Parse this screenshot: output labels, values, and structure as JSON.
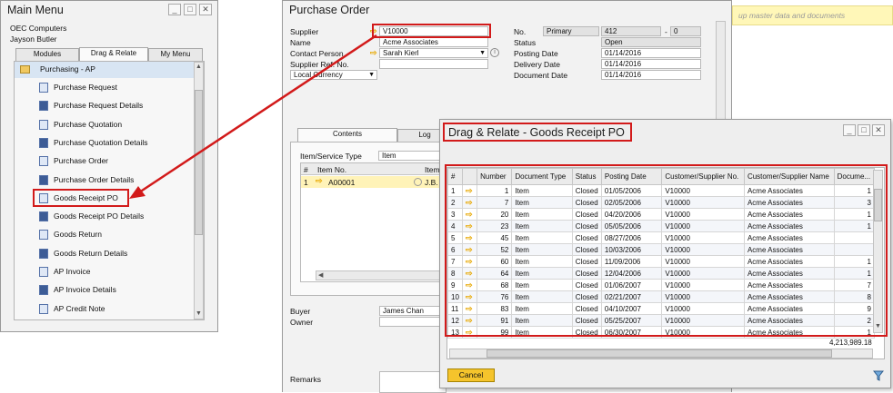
{
  "main_menu": {
    "title": "Main Menu",
    "company": "OEC Computers",
    "user": "Jayson Butler",
    "tabs": [
      "Modules",
      "Drag & Relate",
      "My Menu"
    ],
    "folder": "Purchasing - AP",
    "items": [
      {
        "label": "Purchase Request",
        "icon": "document-icon"
      },
      {
        "label": "Purchase Request Details",
        "icon": "report-icon"
      },
      {
        "label": "Purchase Quotation",
        "icon": "document-icon"
      },
      {
        "label": "Purchase Quotation Details",
        "icon": "report-icon"
      },
      {
        "label": "Purchase Order",
        "icon": "document-icon"
      },
      {
        "label": "Purchase Order Details",
        "icon": "report-icon"
      },
      {
        "label": "Goods Receipt PO",
        "icon": "document-icon"
      },
      {
        "label": "Goods Receipt PO Details",
        "icon": "report-icon"
      },
      {
        "label": "Goods Return",
        "icon": "document-icon"
      },
      {
        "label": "Goods Return Details",
        "icon": "report-icon"
      },
      {
        "label": "AP Invoice",
        "icon": "document-icon"
      },
      {
        "label": "AP Invoice Details",
        "icon": "report-icon"
      },
      {
        "label": "AP Credit Note",
        "icon": "document-icon"
      }
    ]
  },
  "purchase_order": {
    "title": "Purchase Order",
    "supplier_label": "Supplier",
    "supplier_value": "V10000",
    "name_label": "Name",
    "name_value": "Acme Associates",
    "contact_label": "Contact Person",
    "contact_value": "Sarah Kierl",
    "supplier_ref_label": "Supplier Ref. No.",
    "currency_value": "Local Currency",
    "no_label": "No.",
    "no_series": "Primary",
    "no_value": "412",
    "no_dash": "-",
    "no_suffix": "0",
    "status_label": "Status",
    "status_value": "Open",
    "posting_label": "Posting Date",
    "posting_value": "01/14/2016",
    "delivery_label": "Delivery Date",
    "delivery_value": "01/14/2016",
    "docdate_label": "Document Date",
    "docdate_value": "01/14/2016",
    "tabs": [
      "Contents",
      "Log"
    ],
    "item_type_label": "Item/Service Type",
    "item_type_value": "Item",
    "grid_headers": [
      "#",
      "Item No.",
      "Item"
    ],
    "grid_row": {
      "num": "1",
      "item_no": "A00001",
      "item_desc": "J.B. ("
    },
    "buyer_label": "Buyer",
    "buyer_value": "James Chan",
    "owner_label": "Owner",
    "remarks_label": "Remarks"
  },
  "background_hint": "up master data and documents",
  "drag_relate": {
    "title": "Drag & Relate - Goods Receipt PO",
    "headers": [
      "#",
      "",
      "Number",
      "Document Type",
      "Status",
      "Posting Date",
      "Customer/Supplier No.",
      "Customer/Supplier Name",
      "Docume..."
    ],
    "rows": [
      {
        "idx": "1",
        "number": "1",
        "type": "Item",
        "status": "Closed",
        "date": "01/05/2006",
        "cust_no": "V10000",
        "cust_name": "Acme Associates",
        "doc": "1"
      },
      {
        "idx": "2",
        "number": "7",
        "type": "Item",
        "status": "Closed",
        "date": "02/05/2006",
        "cust_no": "V10000",
        "cust_name": "Acme Associates",
        "doc": "3"
      },
      {
        "idx": "3",
        "number": "20",
        "type": "Item",
        "status": "Closed",
        "date": "04/20/2006",
        "cust_no": "V10000",
        "cust_name": "Acme Associates",
        "doc": "1"
      },
      {
        "idx": "4",
        "number": "23",
        "type": "Item",
        "status": "Closed",
        "date": "05/05/2006",
        "cust_no": "V10000",
        "cust_name": "Acme Associates",
        "doc": "1"
      },
      {
        "idx": "5",
        "number": "45",
        "type": "Item",
        "status": "Closed",
        "date": "08/27/2006",
        "cust_no": "V10000",
        "cust_name": "Acme Associates",
        "doc": ""
      },
      {
        "idx": "6",
        "number": "52",
        "type": "Item",
        "status": "Closed",
        "date": "10/03/2006",
        "cust_no": "V10000",
        "cust_name": "Acme Associates",
        "doc": ""
      },
      {
        "idx": "7",
        "number": "60",
        "type": "Item",
        "status": "Closed",
        "date": "11/09/2006",
        "cust_no": "V10000",
        "cust_name": "Acme Associates",
        "doc": "1"
      },
      {
        "idx": "8",
        "number": "64",
        "type": "Item",
        "status": "Closed",
        "date": "12/04/2006",
        "cust_no": "V10000",
        "cust_name": "Acme Associates",
        "doc": "1"
      },
      {
        "idx": "9",
        "number": "68",
        "type": "Item",
        "status": "Closed",
        "date": "01/06/2007",
        "cust_no": "V10000",
        "cust_name": "Acme Associates",
        "doc": "7"
      },
      {
        "idx": "10",
        "number": "76",
        "type": "Item",
        "status": "Closed",
        "date": "02/21/2007",
        "cust_no": "V10000",
        "cust_name": "Acme Associates",
        "doc": "8"
      },
      {
        "idx": "11",
        "number": "83",
        "type": "Item",
        "status": "Closed",
        "date": "04/10/2007",
        "cust_no": "V10000",
        "cust_name": "Acme Associates",
        "doc": "9"
      },
      {
        "idx": "12",
        "number": "91",
        "type": "Item",
        "status": "Closed",
        "date": "05/25/2007",
        "cust_no": "V10000",
        "cust_name": "Acme Associates",
        "doc": "2"
      },
      {
        "idx": "13",
        "number": "99",
        "type": "Item",
        "status": "Closed",
        "date": "06/30/2007",
        "cust_no": "V10000",
        "cust_name": "Acme Associates",
        "doc": "1"
      }
    ],
    "total": "4,213,989.18",
    "cancel_label": "Cancel"
  },
  "colors": {
    "highlight": "#d21a1a",
    "link_arrow": "#e8a800",
    "cancel_button": "#f5c42c",
    "hint_bar": "#fff7b8"
  }
}
